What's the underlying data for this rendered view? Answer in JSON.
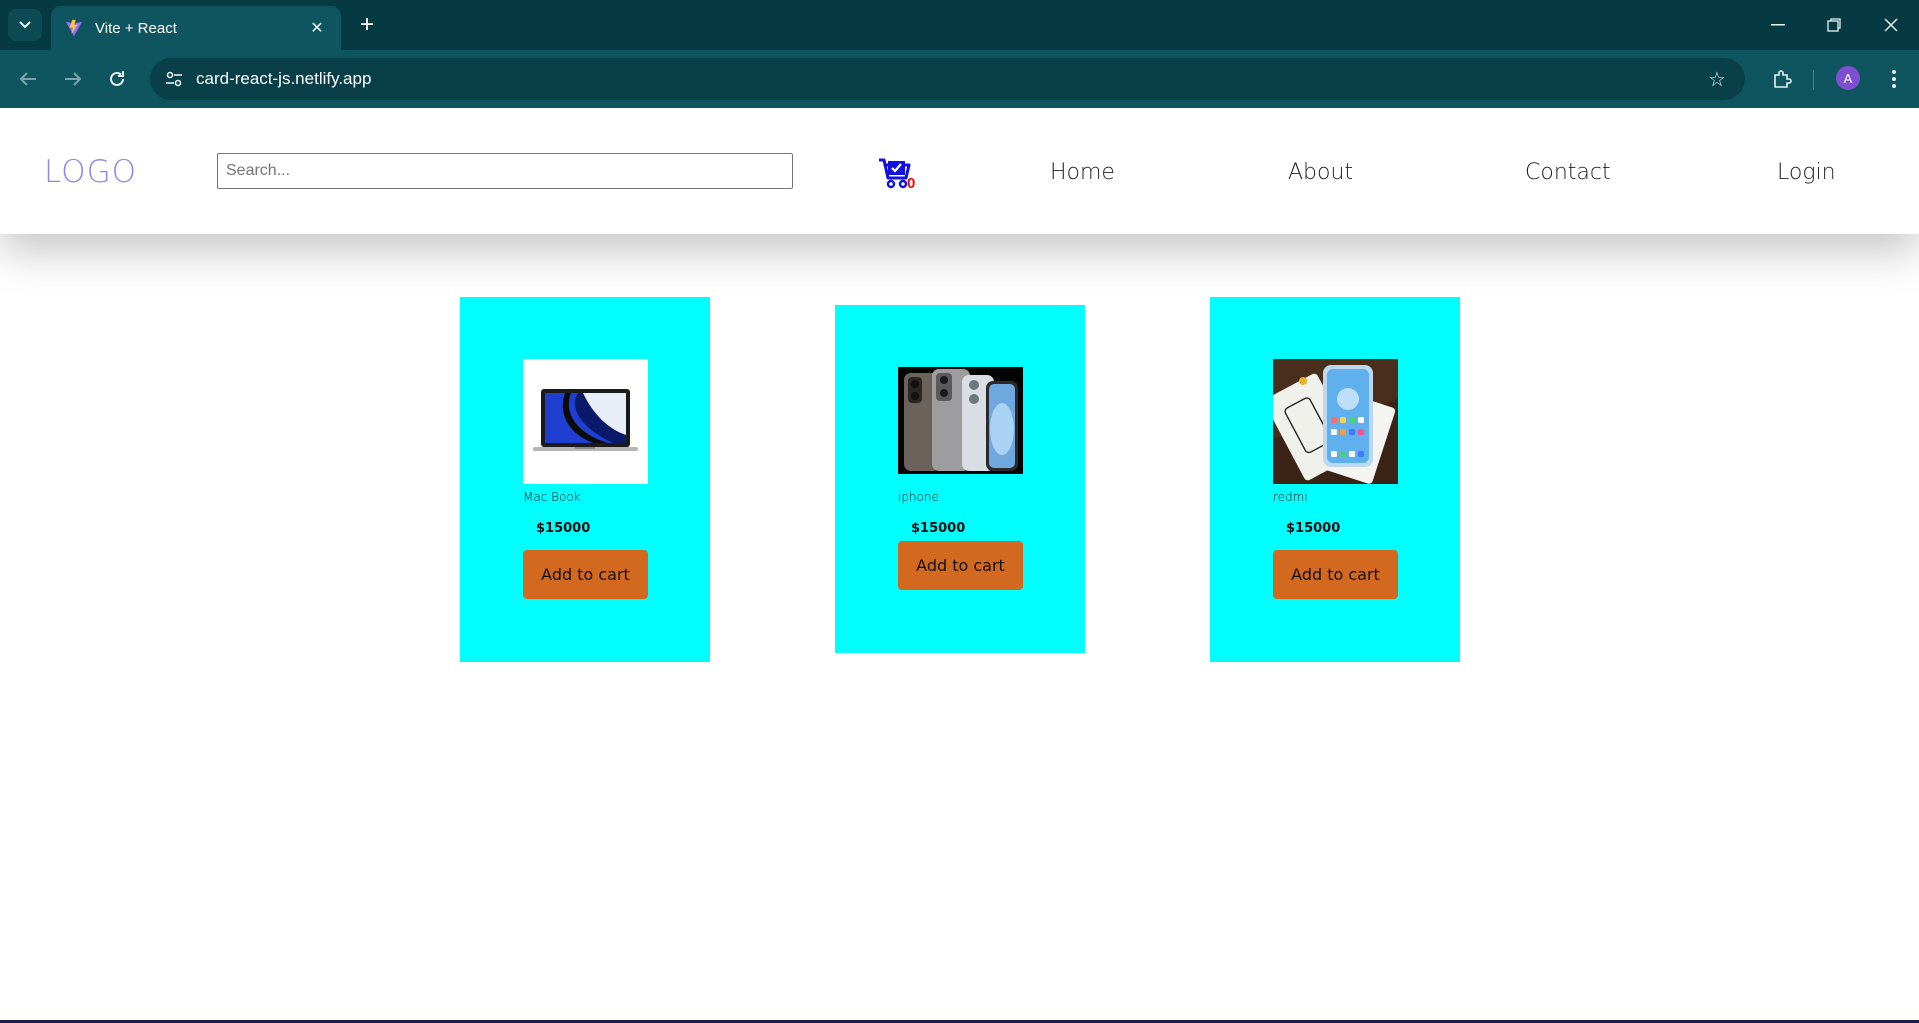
{
  "browser": {
    "tab_title": "Vite + React",
    "url": "card-react-js.netlify.app",
    "profile_initial": "A"
  },
  "navbar": {
    "logo": "LOGO",
    "search_placeholder": "Search...",
    "cart_count": "0",
    "links": [
      "Home",
      "About",
      "Contact",
      "Login"
    ]
  },
  "products": [
    {
      "name": "Mac Book",
      "price": "$15000",
      "button": "Add to cart"
    },
    {
      "name": "iphone",
      "price": "$15000",
      "button": "Add to cart"
    },
    {
      "name": "redmi",
      "price": "$15000",
      "button": "Add to cart"
    }
  ],
  "colors": {
    "card_bg": "#00ffff",
    "button_bg": "#d2691e",
    "logo": "#8c88e8",
    "cart_icon": "#1010e0",
    "cart_count": "#ff0000"
  }
}
